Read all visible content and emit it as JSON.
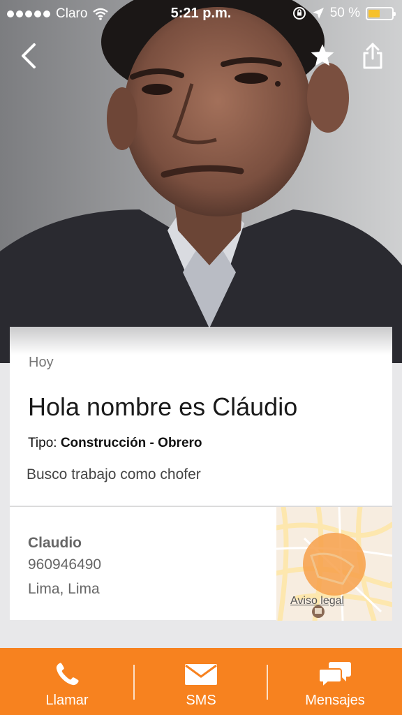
{
  "status_bar": {
    "carrier": "Claro",
    "time": "5:21 p.m.",
    "battery": "50 %",
    "battery_level": 0.5,
    "battery_color": "#f6c12c"
  },
  "header": {
    "back_icon": "chevron-left-icon",
    "favorite_icon": "star-icon",
    "share_icon": "share-icon"
  },
  "post": {
    "date": "Hoy",
    "title": "Hola nombre es Cláudio",
    "tipo_label": "Tipo:",
    "tipo_value": "Construcción - Obrero",
    "description": "Busco trabajo como chofer"
  },
  "contact": {
    "name": "Claudio",
    "phone": "960946490",
    "location": "Lima, Lima"
  },
  "map": {
    "legal_label": "Aviso legal",
    "marker_color": "#f7a04a"
  },
  "bottom_bar": {
    "accent": "#f7821f",
    "tabs": [
      {
        "label": "Llamar",
        "icon": "phone-icon"
      },
      {
        "label": "SMS",
        "icon": "envelope-icon"
      },
      {
        "label": "Mensajes",
        "icon": "chat-bubbles-icon"
      }
    ]
  }
}
